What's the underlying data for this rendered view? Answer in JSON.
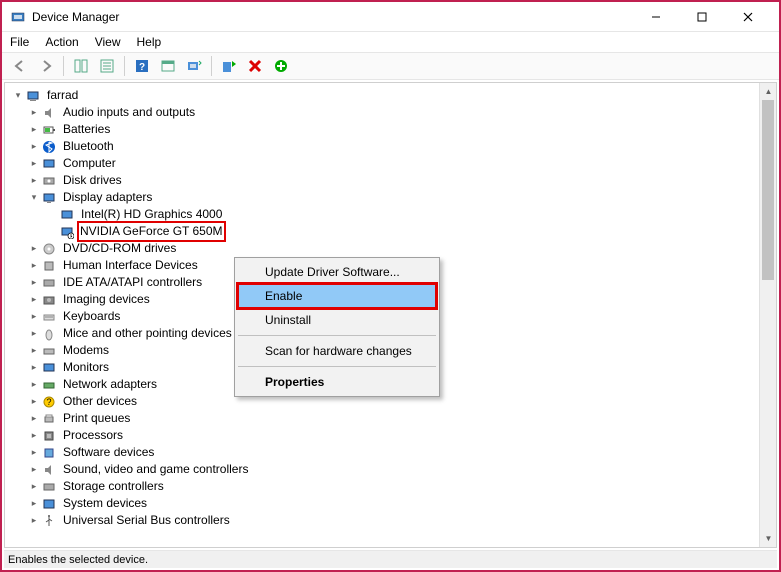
{
  "window": {
    "title": "Device Manager"
  },
  "menubar": {
    "file": "File",
    "action": "Action",
    "view": "View",
    "help": "Help"
  },
  "tree": {
    "root": "farrad",
    "items": [
      "Audio inputs and outputs",
      "Batteries",
      "Bluetooth",
      "Computer",
      "Disk drives",
      "Display adapters",
      "DVD/CD-ROM drives",
      "Human Interface Devices",
      "IDE ATA/ATAPI controllers",
      "Imaging devices",
      "Keyboards",
      "Mice and other pointing devices",
      "Modems",
      "Monitors",
      "Network adapters",
      "Other devices",
      "Print queues",
      "Processors",
      "Software devices",
      "Sound, video and game controllers",
      "Storage controllers",
      "System devices",
      "Universal Serial Bus controllers"
    ],
    "display_children": {
      "intel": "Intel(R) HD Graphics 4000",
      "nvidia": "NVIDIA GeForce GT 650M"
    }
  },
  "context_menu": {
    "update": "Update Driver Software...",
    "enable": "Enable",
    "uninstall": "Uninstall",
    "scan": "Scan for hardware changes",
    "properties": "Properties"
  },
  "statusbar": {
    "text": "Enables the selected device."
  }
}
